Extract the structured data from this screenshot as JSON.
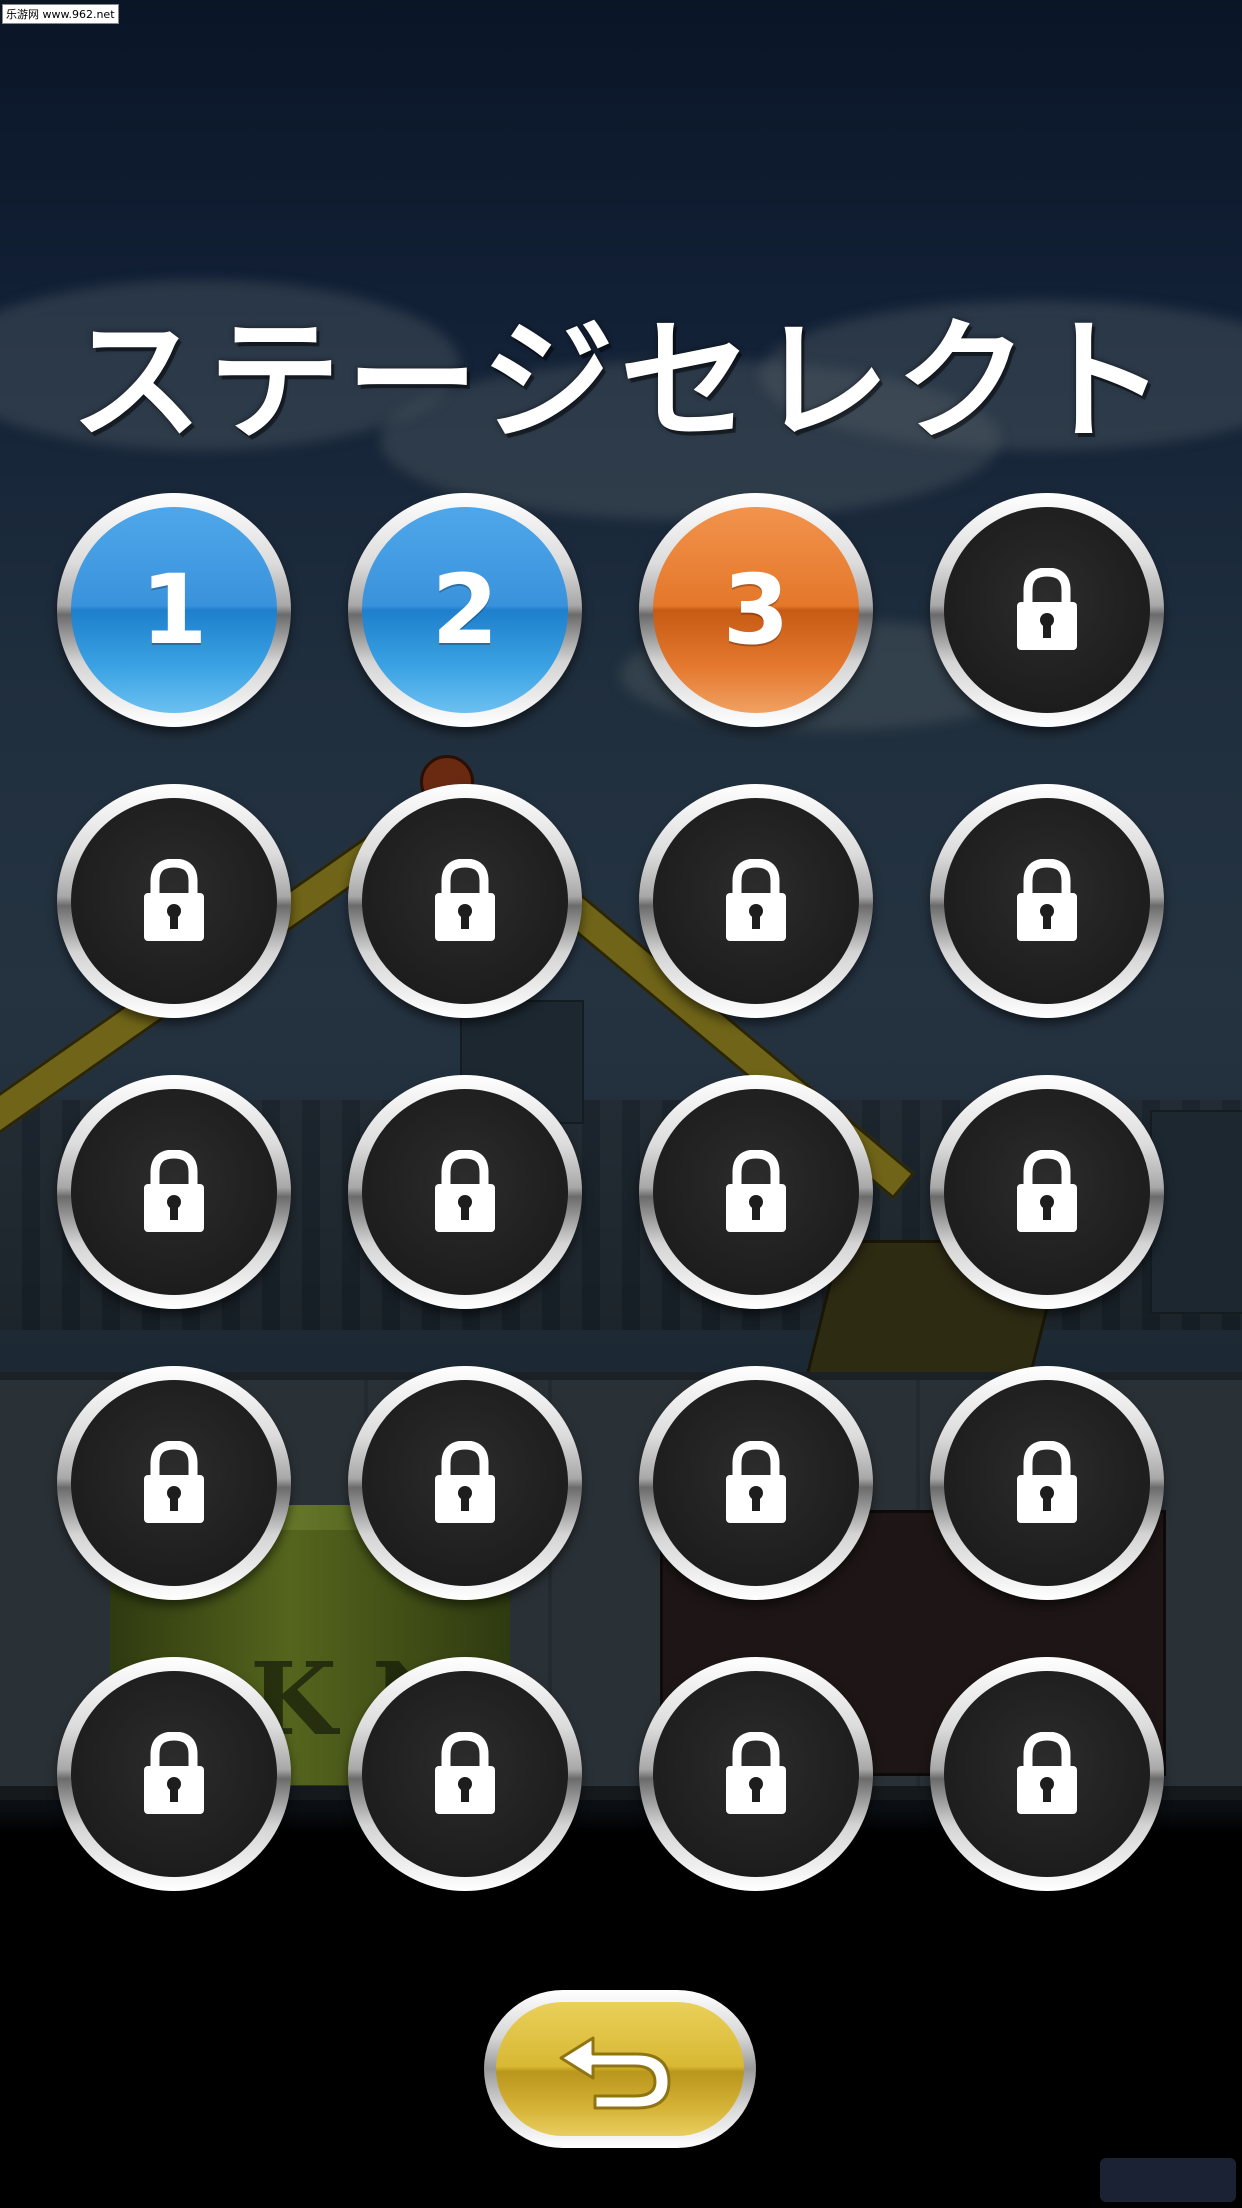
{
  "title": "ステージセレクト",
  "watermark_top": "乐游网 www.962.net",
  "stages": [
    {
      "label": "1",
      "state": "cleared",
      "color": "#3a92dc"
    },
    {
      "label": "2",
      "state": "cleared",
      "color": "#3a92dc"
    },
    {
      "label": "3",
      "state": "current",
      "color": "#e4772a"
    },
    {
      "label": "",
      "state": "locked",
      "icon": "lock-icon"
    },
    {
      "label": "",
      "state": "locked",
      "icon": "lock-icon"
    },
    {
      "label": "",
      "state": "locked",
      "icon": "lock-icon"
    },
    {
      "label": "",
      "state": "locked",
      "icon": "lock-icon"
    },
    {
      "label": "",
      "state": "locked",
      "icon": "lock-icon"
    },
    {
      "label": "",
      "state": "locked",
      "icon": "lock-icon"
    },
    {
      "label": "",
      "state": "locked",
      "icon": "lock-icon"
    },
    {
      "label": "",
      "state": "locked",
      "icon": "lock-icon"
    },
    {
      "label": "",
      "state": "locked",
      "icon": "lock-icon"
    },
    {
      "label": "",
      "state": "locked",
      "icon": "lock-icon"
    },
    {
      "label": "",
      "state": "locked",
      "icon": "lock-icon"
    },
    {
      "label": "",
      "state": "locked",
      "icon": "lock-icon"
    },
    {
      "label": "",
      "state": "locked",
      "icon": "lock-icon"
    },
    {
      "label": "",
      "state": "locked",
      "icon": "lock-icon"
    },
    {
      "label": "",
      "state": "locked",
      "icon": "lock-icon"
    },
    {
      "label": "",
      "state": "locked",
      "icon": "lock-icon"
    },
    {
      "label": "",
      "state": "locked",
      "icon": "lock-icon"
    }
  ],
  "back_button": {
    "icon": "return-arrow-icon",
    "color": "#d8b834"
  },
  "colors": {
    "cleared": "#3a92dc",
    "current": "#e4772a",
    "locked": "#1d1d1d",
    "background": "#1f2e3d"
  }
}
